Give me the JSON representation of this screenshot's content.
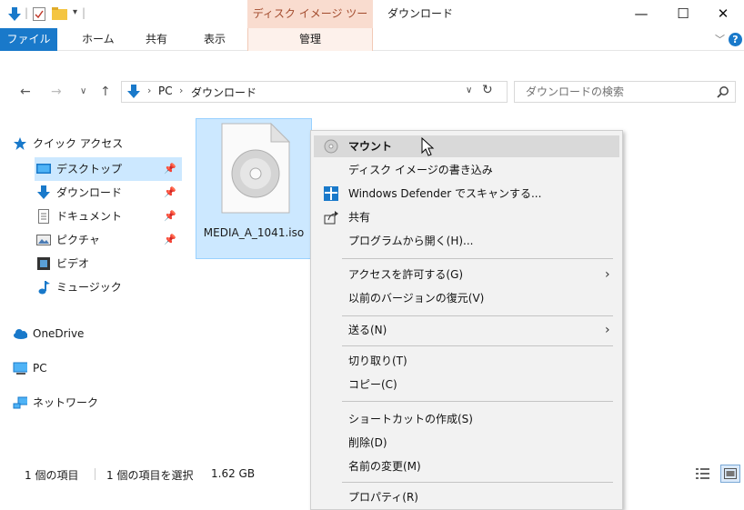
{
  "title_bar": {
    "contextual_tab": "ディスク イメージ ツール",
    "window_title": "ダウンロード",
    "minimize": "—",
    "maximize": "☐",
    "close": "✕"
  },
  "ribbon": {
    "tabs": [
      "ファイル",
      "ホーム",
      "共有",
      "表示"
    ],
    "contextual_tab": "管理",
    "help": "?"
  },
  "address": {
    "path": [
      "PC",
      "ダウンロード"
    ],
    "search_placeholder": "ダウンロードの検索"
  },
  "nav_pane": {
    "quick_access": "クイック アクセス",
    "quick_items": [
      {
        "label": "デスクトップ",
        "pinned": true
      },
      {
        "label": "ダウンロード",
        "pinned": true
      },
      {
        "label": "ドキュメント",
        "pinned": true
      },
      {
        "label": "ピクチャ",
        "pinned": true
      },
      {
        "label": "ビデオ",
        "pinned": false
      },
      {
        "label": "ミュージック",
        "pinned": false
      }
    ],
    "onedrive": "OneDrive",
    "pc": "PC",
    "network": "ネットワーク"
  },
  "content": {
    "file_name": "MEDIA_A_1041.iso"
  },
  "status_bar": {
    "count": "1 個の項目",
    "selected": "1 個の項目を選択",
    "size": "1.62 GB"
  },
  "context_menu": {
    "mount": "マウント",
    "burn": "ディスク イメージの書き込み",
    "defender": "Windows Defender でスキャンする...",
    "share": "共有",
    "open_with": "プログラムから開く(H)...",
    "give_access": "アクセスを許可する(G)",
    "restore": "以前のバージョンの復元(V)",
    "send_to": "送る(N)",
    "cut": "切り取り(T)",
    "copy": "コピー(C)",
    "shortcut": "ショートカットの作成(S)",
    "delete": "削除(D)",
    "rename": "名前の変更(M)",
    "properties": "プロパティ(R)"
  },
  "colors": {
    "accent": "#1979ca",
    "selection": "#cce8ff",
    "contextual_tab": "#f9dccf",
    "folder_yellow": "#f4c542"
  }
}
